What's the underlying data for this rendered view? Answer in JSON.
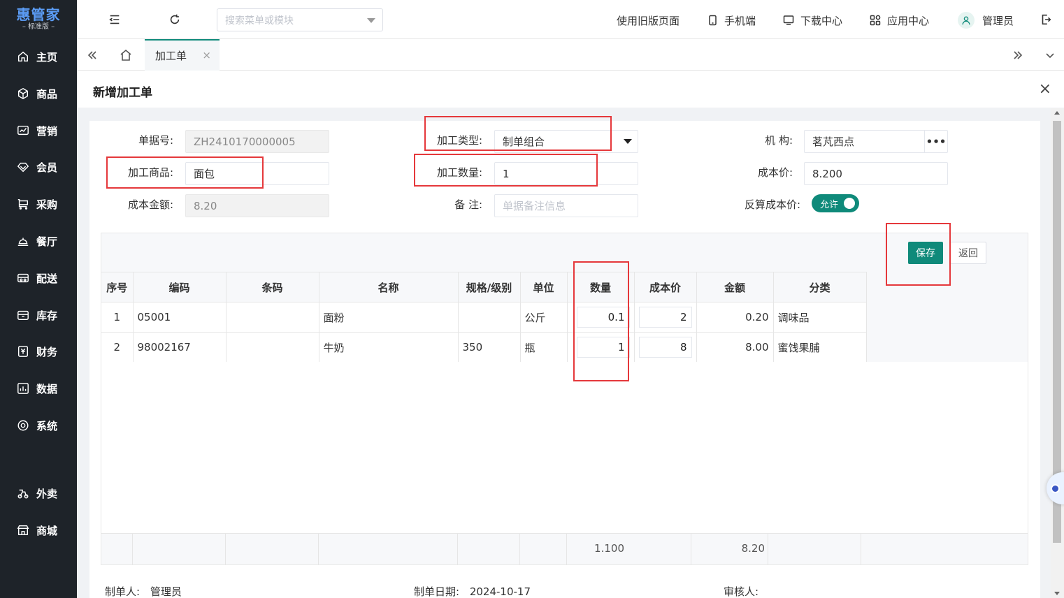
{
  "brand": {
    "name": "惠管家",
    "edition": "– 标准版 –"
  },
  "sidebar": {
    "items": [
      {
        "label": "主页",
        "icon": "home-icon"
      },
      {
        "label": "商品",
        "icon": "box-icon"
      },
      {
        "label": "营销",
        "icon": "chart-icon"
      },
      {
        "label": "会员",
        "icon": "diamond-icon"
      },
      {
        "label": "采购",
        "icon": "cart-icon"
      },
      {
        "label": "餐厅",
        "icon": "bell-icon"
      },
      {
        "label": "配送",
        "icon": "truck-icon"
      },
      {
        "label": "库存",
        "icon": "inventory-icon"
      },
      {
        "label": "财务",
        "icon": "finance-icon"
      },
      {
        "label": "数据",
        "icon": "data-icon"
      },
      {
        "label": "系统",
        "icon": "settings-icon"
      },
      {
        "label": "外卖",
        "icon": "delivery-icon"
      },
      {
        "label": "商城",
        "icon": "store-icon"
      }
    ]
  },
  "topbar": {
    "search_placeholder": "搜索菜单或模块",
    "links": {
      "old_page": "使用旧版页面",
      "mobile": "手机端",
      "download": "下载中心",
      "apps": "应用中心",
      "user": "管理员"
    }
  },
  "tabs": {
    "active": "加工单",
    "close": "×"
  },
  "page": {
    "title": "新增加工单",
    "close": "×"
  },
  "form": {
    "doc_no_label": "单据号:",
    "doc_no": "ZH2410170000005",
    "type_label": "加工类型:",
    "type_value": "制单组合",
    "org_label": "机 构:",
    "org_value": "茗芃西点",
    "org_more": "•••",
    "product_label": "加工商品:",
    "product_value": "面包",
    "qty_label": "加工数量:",
    "qty_value": "1",
    "cost_price_label": "成本价:",
    "cost_price_value": "8.200",
    "cost_amount_label": "成本金额:",
    "cost_amount_value": "8.20",
    "remark_label": "备 注:",
    "remark_placeholder": "单据备注信息",
    "recalc_label": "反算成本价:",
    "recalc_toggle": "允许"
  },
  "actions": {
    "save": "保存",
    "back": "返回"
  },
  "table": {
    "headers": [
      "序号",
      "编码",
      "条码",
      "名称",
      "规格/级别",
      "单位",
      "数量",
      "成本价",
      "金额",
      "分类"
    ],
    "rows": [
      {
        "no": "1",
        "code": "05001",
        "barcode": "",
        "name": "面粉",
        "spec": "",
        "unit": "公斤",
        "qty": "0.1",
        "price": "2",
        "amount": "0.20",
        "category": "调味品"
      },
      {
        "no": "2",
        "code": "98002167",
        "barcode": "",
        "name": "牛奶",
        "spec": "350",
        "unit": "瓶",
        "qty": "1",
        "price": "8",
        "amount": "8.00",
        "category": "蜜饯果脯"
      }
    ],
    "footer": {
      "qty_total": "1.100",
      "amount_total": "8.20"
    }
  },
  "bottom": {
    "creator_label": "制单人:",
    "creator": "管理员",
    "date_label": "制单日期:",
    "date": "2024-10-17",
    "auditor_label": "审核人:"
  },
  "colors": {
    "accent": "#0f8a7a",
    "sidebar": "#1e2329",
    "highlight": "#e5383b"
  }
}
